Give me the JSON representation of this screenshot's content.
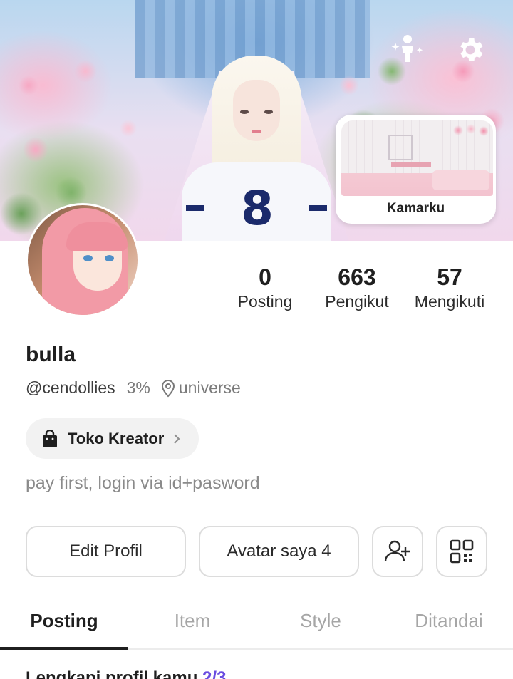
{
  "header": {
    "avatar_icon": "avatar-sparkle-icon",
    "settings_icon": "gear-icon",
    "room_card": {
      "label": "Kamarku"
    }
  },
  "profile": {
    "display_name": "bulla",
    "handle": "@cendollies",
    "percent": "3%",
    "location": "universe",
    "bio": "pay first, login via id+pasword"
  },
  "stats": [
    {
      "value": "0",
      "label": "Posting"
    },
    {
      "value": "663",
      "label": "Pengikut"
    },
    {
      "value": "57",
      "label": "Mengikuti"
    }
  ],
  "shop": {
    "label": "Toko Kreator"
  },
  "actions": {
    "edit_label": "Edit Profil",
    "avatar_label": "Avatar saya 4",
    "add_friend_icon": "add-user-icon",
    "qr_icon": "qr-code-icon"
  },
  "tabs": [
    {
      "label": "Posting",
      "active": true
    },
    {
      "label": "Item",
      "active": false
    },
    {
      "label": "Style",
      "active": false
    },
    {
      "label": "Ditandai",
      "active": false
    }
  ],
  "complete_profile": {
    "text": "Lengkapi profil kamu ",
    "progress": "2/3"
  },
  "colors": {
    "accent": "#6a4ce0",
    "text": "#1f1f1f",
    "muted": "#8a8a8a",
    "border": "#dcdcdc"
  }
}
